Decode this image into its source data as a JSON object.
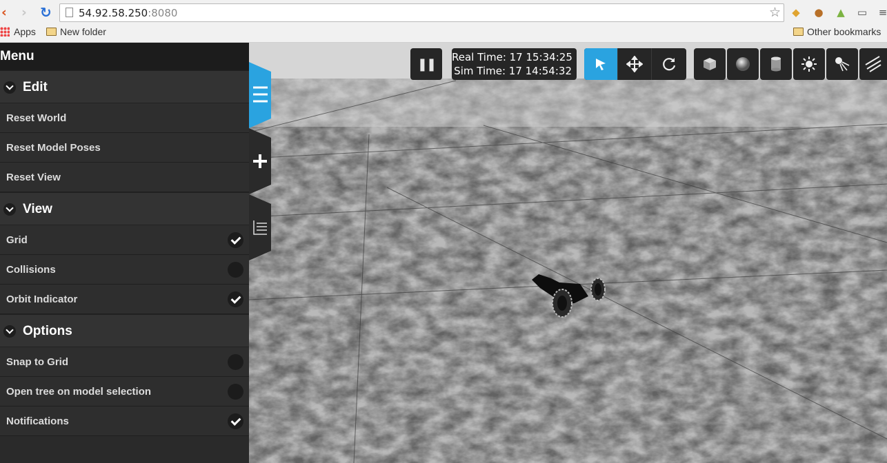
{
  "browser": {
    "back_icon": "‹",
    "forward_icon": "›",
    "reload_icon": "↻",
    "url_host": "54.92.58.250",
    "url_port": ":8080",
    "star_icon": "☆",
    "bookmarks": {
      "apps": "Apps",
      "new_folder": "New folder",
      "other": "Other bookmarks"
    }
  },
  "toolbar": {
    "pause_icon": "❚❚",
    "real_time": "Real Time: 17 15:34:25",
    "sim_time": "Sim Time: 17 14:54:32",
    "active_tool": "select",
    "accent_color": "#2aa3e0"
  },
  "menu": {
    "title": "Menu",
    "sections": [
      {
        "header": "Edit",
        "items": [
          {
            "label": "Reset World"
          },
          {
            "label": "Reset Model Poses"
          },
          {
            "label": "Reset View"
          }
        ]
      },
      {
        "header": "View",
        "items": [
          {
            "label": "Grid",
            "checked": true
          },
          {
            "label": "Collisions",
            "checked": false
          },
          {
            "label": "Orbit Indicator",
            "checked": true
          }
        ]
      },
      {
        "header": "Options",
        "items": [
          {
            "label": "Snap to Grid",
            "checked": false
          },
          {
            "label": "Open tree on model selection",
            "checked": false
          },
          {
            "label": "Notifications",
            "checked": true
          }
        ]
      }
    ]
  }
}
